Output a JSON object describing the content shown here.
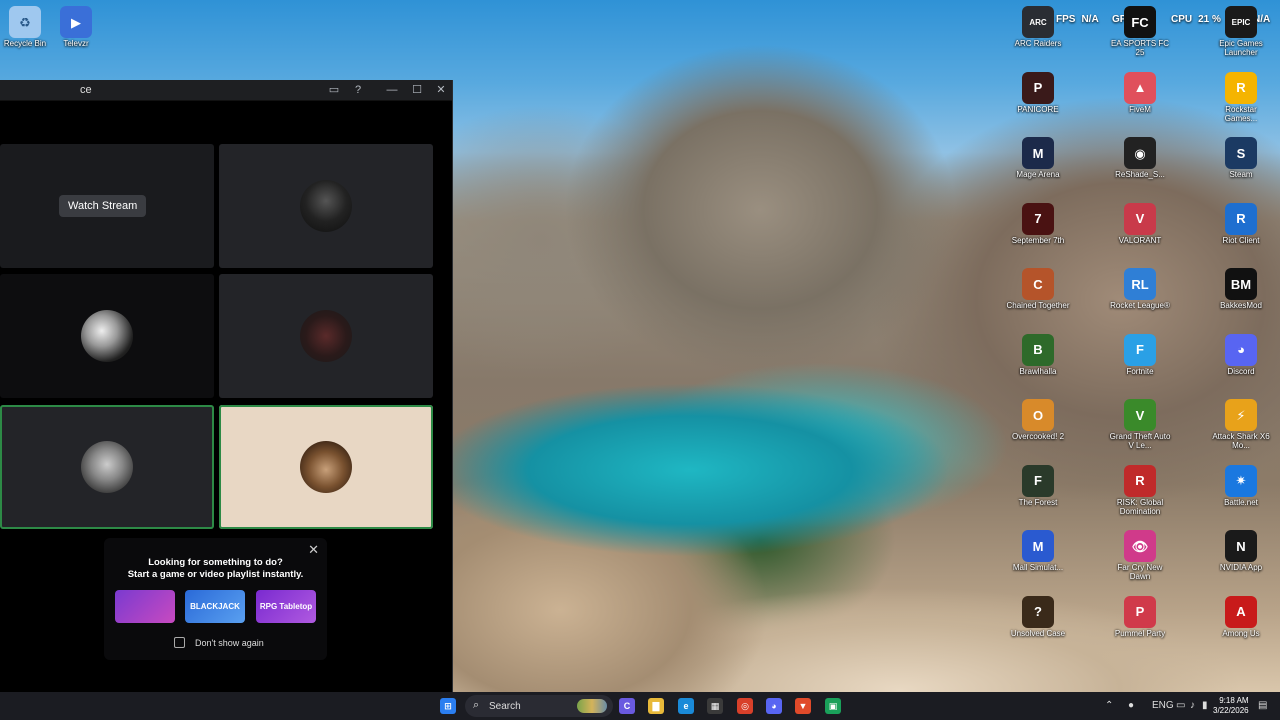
{
  "desktop_icons_left": [
    {
      "label": "Recycle Bin",
      "icon": "recycle-bin-icon",
      "color": "#9fc8ef",
      "glyph": "♻"
    },
    {
      "label": "Televzr",
      "icon": "televzr-icon",
      "color": "#3a6fd8",
      "glyph": "▶"
    }
  ],
  "hud": {
    "fps_label": "FPS",
    "fps_value": "N/A",
    "gpu_label": "GPU",
    "gpu_value": "%",
    "cpu_label": "CPU",
    "cpu_value": "21 %",
    "extra_value": "N/A"
  },
  "desktop_icons_right": [
    {
      "label": "ARC Raiders",
      "icon": "arc-raiders-icon",
      "color": "#2a2d33",
      "glyph": "ARC"
    },
    {
      "label": "EA SPORTS FC 25",
      "icon": "ea-fc-icon",
      "color": "#111111",
      "glyph": "FC"
    },
    {
      "label": "Epic Games Launcher",
      "icon": "epic-games-icon",
      "color": "#1a1a1a",
      "glyph": "EPIC"
    },
    {
      "label": "PANICORE",
      "icon": "panicore-icon",
      "color": "#3a1a1a",
      "glyph": "P"
    },
    {
      "label": "FiveM",
      "icon": "fivem-icon",
      "color": "#e0505c",
      "glyph": "▲"
    },
    {
      "label": "Rockstar Games...",
      "icon": "rockstar-icon",
      "color": "#f5b400",
      "glyph": "R"
    },
    {
      "label": "Mage Arena",
      "icon": "mage-arena-icon",
      "color": "#1c2a4a",
      "glyph": "M"
    },
    {
      "label": "ReShade_S...",
      "icon": "reshade-icon",
      "color": "#222222",
      "glyph": "◉"
    },
    {
      "label": "Steam",
      "icon": "steam-icon",
      "color": "#1b3a63",
      "glyph": "S"
    },
    {
      "label": "September 7th",
      "icon": "september-icon",
      "color": "#4a1212",
      "glyph": "7"
    },
    {
      "label": "VALORANT",
      "icon": "valorant-icon",
      "color": "#c93a4a",
      "glyph": "V"
    },
    {
      "label": "Riot Client",
      "icon": "riot-client-icon",
      "color": "#1e6fd0",
      "glyph": "R"
    },
    {
      "label": "Chained Together",
      "icon": "chained-together-icon",
      "color": "#b5542a",
      "glyph": "C"
    },
    {
      "label": "Rocket League®",
      "icon": "rocket-league-icon",
      "color": "#2f7fd6",
      "glyph": "RL"
    },
    {
      "label": "BakkesMod",
      "icon": "bakkesmod-icon",
      "color": "#111111",
      "glyph": "BM"
    },
    {
      "label": "Brawlhalla",
      "icon": "brawlhalla-icon",
      "color": "#2e6a2a",
      "glyph": "B"
    },
    {
      "label": "Fortnite",
      "icon": "fortnite-icon",
      "color": "#2aa0e6",
      "glyph": "F"
    },
    {
      "label": "Discord",
      "icon": "discord-icon",
      "color": "#5865f2",
      "glyph": "◕"
    },
    {
      "label": "Overcooked! 2",
      "icon": "overcooked-icon",
      "color": "#d88a2a",
      "glyph": "O"
    },
    {
      "label": "Grand Theft Auto V Le...",
      "icon": "gta-icon",
      "color": "#3a8a2a",
      "glyph": "V"
    },
    {
      "label": "Attack Shark X6 Mo...",
      "icon": "attack-shark-icon",
      "color": "#e8a21a",
      "glyph": "⚡"
    },
    {
      "label": "The Forest",
      "icon": "the-forest-icon",
      "color": "#2a3a2a",
      "glyph": "F"
    },
    {
      "label": "RISK: Global Domination",
      "icon": "risk-icon",
      "color": "#c02a2a",
      "glyph": "R"
    },
    {
      "label": "Battle.net",
      "icon": "battlenet-icon",
      "color": "#1a78e0",
      "glyph": "✷"
    },
    {
      "label": "Mall Simulat...",
      "icon": "mall-simulator-icon",
      "color": "#2a5ad0",
      "glyph": "M"
    },
    {
      "label": "Far Cry New Dawn",
      "icon": "far-cry-icon",
      "color": "#d03a8a",
      "glyph": "👁"
    },
    {
      "label": "NVIDIA App",
      "icon": "nvidia-icon",
      "color": "#1a1a1a",
      "glyph": "N"
    },
    {
      "label": "Unsolved Case",
      "icon": "unsolved-case-icon",
      "color": "#3a2a1a",
      "glyph": "?"
    },
    {
      "label": "Pummel Party",
      "icon": "pummel-party-icon",
      "color": "#d03a4a",
      "glyph": "P"
    },
    {
      "label": "Among Us",
      "icon": "among-us-icon",
      "color": "#c81a1a",
      "glyph": "A"
    }
  ],
  "window": {
    "title": "ce",
    "watch_stream_label": "Watch Stream",
    "promo": {
      "line1": "Looking for something to do?",
      "line2": "Start a game or video playlist instantly.",
      "activities": [
        {
          "label": "",
          "color": "#7a3ad0"
        },
        {
          "label": "BLACKJACK",
          "color": "#3a7ad8"
        },
        {
          "label": "RPG Tabletop",
          "color": "#8a3ad8"
        }
      ],
      "dont_show_label": "Don't show again"
    }
  },
  "taskbar": {
    "search_label": "Search",
    "clock_time": "9:18 AM",
    "clock_date": "3/22/2026",
    "tray_lang": "ENG"
  }
}
